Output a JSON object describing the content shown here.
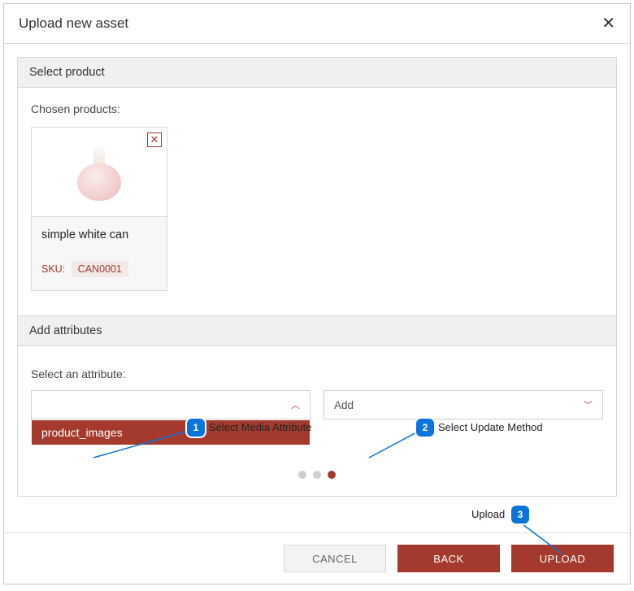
{
  "dialog": {
    "title": "Upload new asset"
  },
  "select_product": {
    "header": "Select product",
    "chosen_label": "Chosen products:",
    "product": {
      "name": "simple white can",
      "sku_label": "SKU:",
      "sku_value": "CAN0001"
    }
  },
  "add_attributes": {
    "header": "Add attributes",
    "select_attr_label": "Select an attribute:",
    "media_select": {
      "value": "",
      "open_option": "product_images"
    },
    "method_select": {
      "value": "Add"
    }
  },
  "footer": {
    "cancel": "CANCEL",
    "back": "BACK",
    "upload": "UPLOAD"
  },
  "annotations": {
    "a1": {
      "num": "1",
      "label": "Select Media Attribute"
    },
    "a2": {
      "num": "2",
      "label": "Select Update Method"
    },
    "a3": {
      "num": "3",
      "label": "Upload"
    }
  }
}
